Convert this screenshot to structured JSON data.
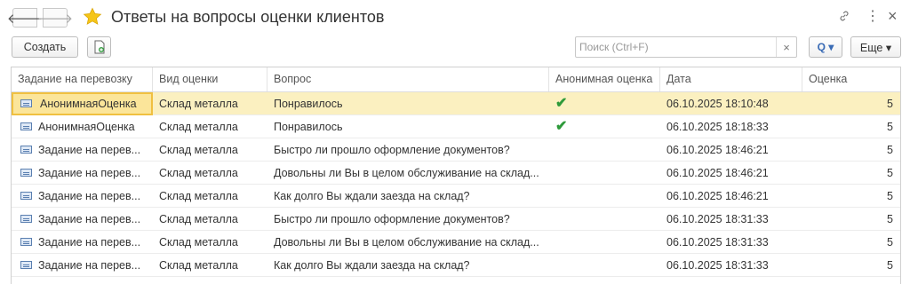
{
  "window": {
    "title": "Ответы на вопросы оценки клиентов"
  },
  "toolbar": {
    "create_label": "Создать",
    "search_placeholder": "Поиск (Ctrl+F)",
    "search_clear": "×",
    "find_label": "Q ▾",
    "more_label": "Еще ▾"
  },
  "table": {
    "columns": [
      "Задание на перевозку",
      "Вид оценки",
      "Вопрос",
      "Анонимная оценка",
      "Дата",
      "Оценка"
    ],
    "rows": [
      {
        "task": "АнонимнаяОценка",
        "kind": "Склад металла",
        "question": "Понравилось",
        "anon": "✔",
        "date": "06.10.2025 18:10:48",
        "score": "5"
      },
      {
        "task": "АнонимнаяОценка",
        "kind": "Склад металла",
        "question": "Понравилось",
        "anon": "✔",
        "date": "06.10.2025 18:18:33",
        "score": "5"
      },
      {
        "task": "Задание на перев...",
        "kind": "Склад металла",
        "question": "Быстро ли прошло оформление документов?",
        "anon": "",
        "date": "06.10.2025 18:46:21",
        "score": "5"
      },
      {
        "task": "Задание на перев...",
        "kind": "Склад металла",
        "question": "Довольны ли Вы в целом обслуживание на склад...",
        "anon": "",
        "date": "06.10.2025 18:46:21",
        "score": "5"
      },
      {
        "task": "Задание на перев...",
        "kind": "Склад металла",
        "question": "Как долго Вы ждали заезда на склад?",
        "anon": "",
        "date": "06.10.2025 18:46:21",
        "score": "5"
      },
      {
        "task": "Задание на перев...",
        "kind": "Склад металла",
        "question": "Быстро ли прошло оформление документов?",
        "anon": "",
        "date": "06.10.2025 18:31:33",
        "score": "5"
      },
      {
        "task": "Задание на перев...",
        "kind": "Склад металла",
        "question": "Довольны ли Вы в целом обслуживание на склад...",
        "anon": "",
        "date": "06.10.2025 18:31:33",
        "score": "5"
      },
      {
        "task": "Задание на перев...",
        "kind": "Склад металла",
        "question": "Как долго Вы ждали заезда на склад?",
        "anon": "",
        "date": "06.10.2025 18:31:33",
        "score": "5"
      }
    ]
  },
  "colors": {
    "selected_row": "#fbf0c0",
    "focus_border": "#f0c040",
    "check": "#2e9a3a",
    "star": "#f5c518"
  }
}
